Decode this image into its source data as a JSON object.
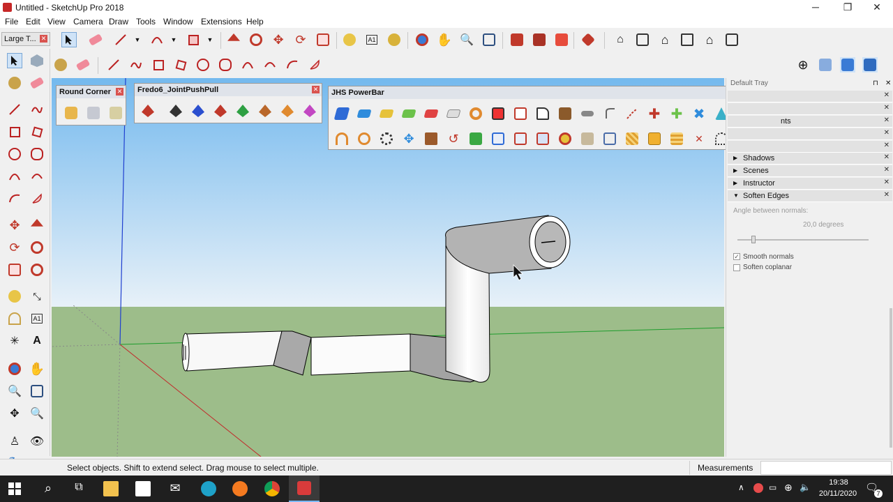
{
  "window": {
    "title": "Untitled - SketchUp Pro 2018",
    "minimize": "─",
    "restore": "❐",
    "close": "✕"
  },
  "menu": [
    "File",
    "Edit",
    "View",
    "Camera",
    "Draw",
    "Tools",
    "Window",
    "Extensions",
    "Help"
  ],
  "large_tool_set": {
    "title": "Large T..."
  },
  "toolbars": {
    "round_corner": {
      "title": "Round Corner"
    },
    "joint_push_pull": {
      "title": "Fredo6_JointPushPull"
    },
    "jhs_powerbar": {
      "title": "JHS PowerBar"
    }
  },
  "tray": {
    "header": "Default Tray",
    "partial_label": "nts",
    "items": [
      {
        "label": "Shadows",
        "expanded": false
      },
      {
        "label": "Scenes",
        "expanded": false
      },
      {
        "label": "Instructor",
        "expanded": false
      },
      {
        "label": "Soften Edges",
        "expanded": true
      }
    ],
    "soften_edges": {
      "angle_label": "Angle between normals:",
      "angle_value": "20,0  degrees",
      "angle_fraction": 0.12,
      "smooth_normals": "Smooth normals",
      "smooth_checked": true,
      "soften_coplanar": "Soften coplanar",
      "coplanar_checked": false
    }
  },
  "status": {
    "hint": "Select objects. Shift to extend select. Drag mouse to select multiple.",
    "measurements_label": "Measurements",
    "measurements_value": ""
  },
  "taskbar": {
    "time": "19:38",
    "date": "20/11/2020",
    "notification_count": "7"
  },
  "colors": {
    "sky_top": "#74b9ee",
    "sky_bottom": "#e8f1f8",
    "ground": "#9dbd8a",
    "tray_bg": "#f0f0f0",
    "taskbar": "#1f1f1f",
    "accent_red": "#d9534f"
  }
}
